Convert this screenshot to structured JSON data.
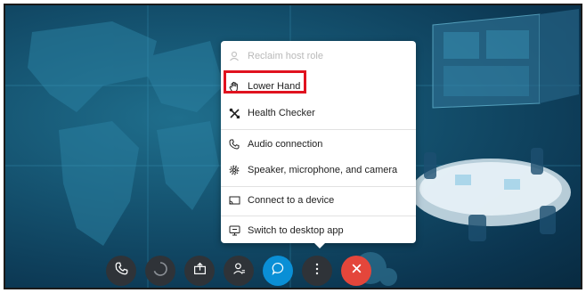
{
  "menu": {
    "items": [
      {
        "label": "Reclaim host role",
        "icon": "person-crown-icon",
        "disabled": true
      },
      {
        "label": "Lower Hand",
        "icon": "raised-hand-icon",
        "disabled": false
      },
      {
        "label": "Health Checker",
        "icon": "tools-icon",
        "disabled": false
      },
      {
        "label": "Audio connection",
        "icon": "phone-icon",
        "disabled": false
      },
      {
        "label": "Speaker, microphone, and camera",
        "icon": "gear-icon",
        "disabled": false
      },
      {
        "label": "Connect to a device",
        "icon": "cast-icon",
        "disabled": false
      },
      {
        "label": "Switch to desktop app",
        "icon": "desktop-icon",
        "disabled": false
      }
    ]
  },
  "controls": [
    {
      "name": "call-button",
      "icon": "phone-icon"
    },
    {
      "name": "loading-button",
      "icon": "spinner-icon"
    },
    {
      "name": "share-button",
      "icon": "share-icon"
    },
    {
      "name": "participants-button",
      "icon": "participants-icon"
    },
    {
      "name": "chat-button",
      "icon": "chat-icon"
    },
    {
      "name": "more-options-button",
      "icon": "more-vertical-icon"
    },
    {
      "name": "leave-button",
      "icon": "close-icon"
    }
  ],
  "colors": {
    "highlight": "#e0121f",
    "chat_button": "#0a8fd6",
    "leave_button": "#e4463b",
    "control_button": "#2f3338"
  }
}
